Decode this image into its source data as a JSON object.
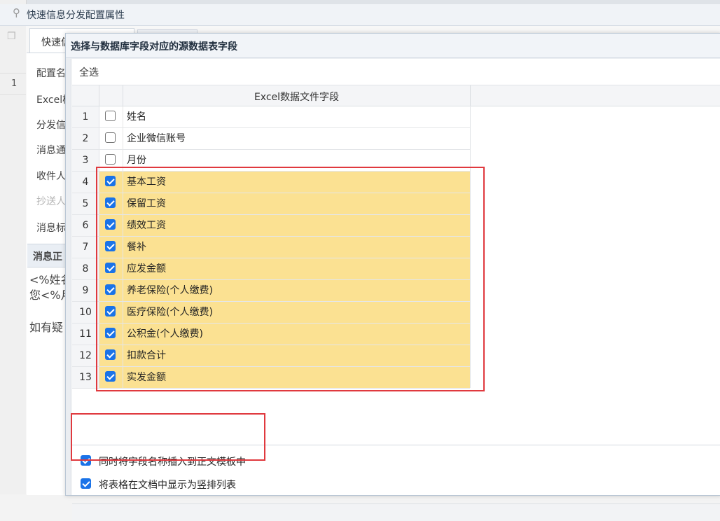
{
  "window": {
    "title": "快速信息分发配置属性",
    "tab_first": "快速信",
    "row_number": "1"
  },
  "background_form": {
    "labels": [
      "配置名",
      "Excel模",
      "分发信",
      "消息通",
      "收件人",
      "抄送人",
      "消息标"
    ],
    "message_section": "消息正",
    "body_lines": [
      "<%姓名",
      "您<%月",
      "如有疑"
    ]
  },
  "dialog": {
    "title": "选择与数据库字段对应的源数据表字段",
    "select_all": "全选",
    "column_header": "Excel数据文件字段",
    "rows": [
      {
        "num": "1",
        "field": "姓名",
        "checked": false
      },
      {
        "num": "2",
        "field": "企业微信账号",
        "checked": false
      },
      {
        "num": "3",
        "field": "月份",
        "checked": false
      },
      {
        "num": "4",
        "field": "基本工资",
        "checked": true
      },
      {
        "num": "5",
        "field": "保留工资",
        "checked": true
      },
      {
        "num": "6",
        "field": "绩效工资",
        "checked": true
      },
      {
        "num": "7",
        "field": "餐补",
        "checked": true
      },
      {
        "num": "8",
        "field": "应发金额",
        "checked": true
      },
      {
        "num": "9",
        "field": "养老保险(个人缴费)",
        "checked": true
      },
      {
        "num": "10",
        "field": "医疗保险(个人缴费)",
        "checked": true
      },
      {
        "num": "11",
        "field": "公积金(个人缴费)",
        "checked": true
      },
      {
        "num": "12",
        "field": "扣款合计",
        "checked": true
      },
      {
        "num": "13",
        "field": "实发金额",
        "checked": true
      }
    ],
    "options": [
      {
        "label": "同时将字段名称插入到正文模板中",
        "checked": true
      },
      {
        "label": "将表格在文档中显示为竖排列表",
        "checked": true
      }
    ]
  },
  "colors": {
    "selected_row": "#fbe192",
    "highlight_border": "#e0393e",
    "checkbox_checked": "#1a73e8"
  }
}
